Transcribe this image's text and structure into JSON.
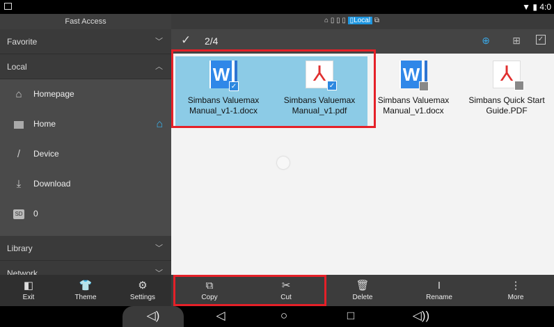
{
  "status": {
    "time": "4:0"
  },
  "sidebar": {
    "title": "Fast Access",
    "favorite": "Favorite",
    "local": "Local",
    "items": [
      {
        "label": "Homepage",
        "icon": "house-outline-icon"
      },
      {
        "label": "Home",
        "icon": "home-folder-icon"
      },
      {
        "label": "Device",
        "icon": "slash-icon"
      },
      {
        "label": "Download",
        "icon": "download-icon"
      },
      {
        "label": "0",
        "icon": "sd-card-icon",
        "badge": "SD"
      }
    ],
    "library": "Library",
    "network": "Network"
  },
  "breadcrumb": {
    "local": "Local"
  },
  "selection": {
    "count": "2/4"
  },
  "files": [
    {
      "name": "Simbans Valuemax Manual_v1-1.docx",
      "type": "word",
      "selected": true
    },
    {
      "name": "Simbans Valuemax Manual_v1.pdf",
      "type": "pdf",
      "selected": true
    },
    {
      "name": "Simbans Valuemax Manual_v1.docx",
      "type": "word",
      "selected": false
    },
    {
      "name": "Simbans Quick Start Guide.PDF",
      "type": "pdf",
      "selected": false
    }
  ],
  "left_toolbar": {
    "exit": "Exit",
    "theme": "Theme",
    "settings": "Settings"
  },
  "actions": {
    "copy": "Copy",
    "cut": "Cut",
    "delete": "Delete",
    "rename": "Rename",
    "more": "More"
  },
  "colors": {
    "accent": "#39b5f0",
    "selected": "#8ccbe6",
    "highlight": "#e52028"
  }
}
